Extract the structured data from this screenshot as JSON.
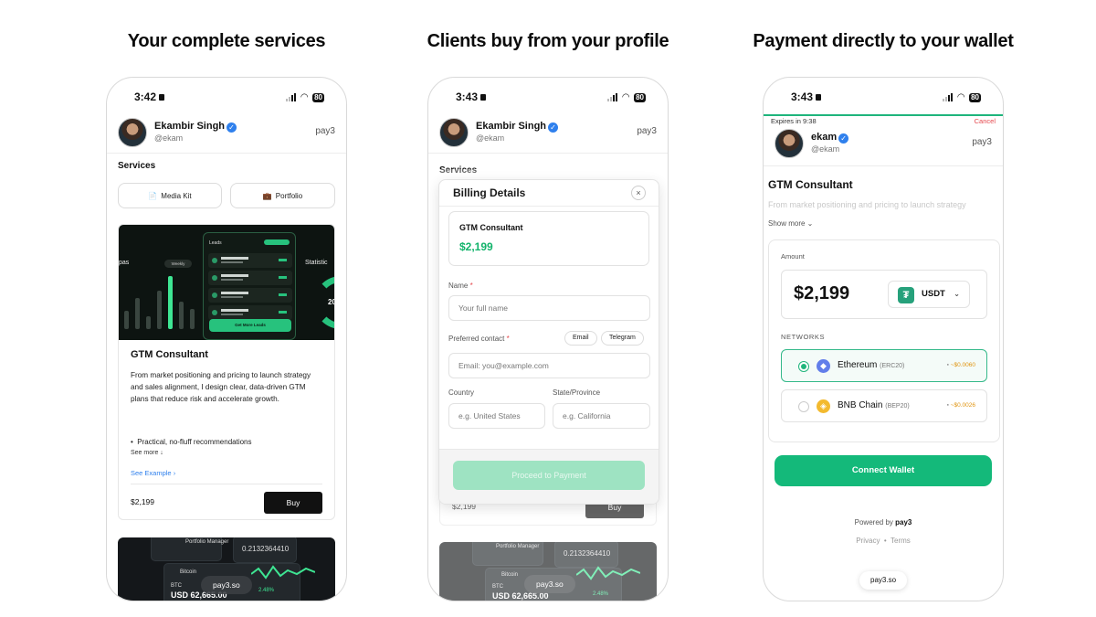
{
  "headings": [
    "Your complete services",
    "Clients buy from your profile",
    "Payment directly to your wallet"
  ],
  "status": {
    "p1_time": "3:42",
    "p2_time": "3:43",
    "p3_time": "3:43",
    "battery": "80"
  },
  "profile": {
    "name": "Ekambir Singh",
    "handle": "@ekam",
    "brand": "pay3",
    "short_name": "ekam"
  },
  "services": {
    "title": "Services",
    "media_kit": "Media Kit",
    "portfolio": "Portfolio"
  },
  "dashboard": {
    "leads": "Leads",
    "weekly": "Weekly",
    "get_more": "Get More Leads",
    "statistic": "Statistic",
    "pas": "pas",
    "ring_value": "20"
  },
  "service_card": {
    "title": "GTM Consultant",
    "description": "From market positioning and pricing to launch strategy and sales alignment, I design clear, data-driven GTM plans that reduce risk and accelerate growth.",
    "bullet": "Practical, no-fluff recommendations",
    "see_more": "See more ↓",
    "see_example": "See Example",
    "price": "$2,199",
    "buy": "Buy"
  },
  "promo": {
    "portfolio_manager": "Portfolio Manager",
    "big_number": "0.2132364410",
    "coin": "Bitcoin",
    "btc": "BTC",
    "usd": "USD 62,665.00",
    "pct": "2.48%",
    "pill": "pay3.so"
  },
  "billing": {
    "title": "Billing Details",
    "close": "×",
    "service_name": "GTM Consultant",
    "service_price": "$2,199",
    "name_label": "Name",
    "name_placeholder": "Your full name",
    "contact_label": "Preferred contact",
    "chip_email": "Email",
    "chip_telegram": "Telegram",
    "email_placeholder": "Email: you@example.com",
    "country_label": "Country",
    "country_placeholder": "e.g. United States",
    "state_label": "State/Province",
    "state_placeholder": "e.g. California",
    "proceed": "Proceed to Payment",
    "underlay_price": "$2,199",
    "underlay_buy": "Buy"
  },
  "payment": {
    "expires": "Expires in 9:38",
    "cancel": "Cancel",
    "title": "GTM Consultant",
    "desc": "From market positioning and pricing to launch strategy",
    "show_more": "Show more ⌄",
    "amount_label": "Amount",
    "amount": "$2,199",
    "token": "USDT",
    "networks_label": "NETWORKS",
    "networks": [
      {
        "name": "Ethereum",
        "tag": "(ERC20)",
        "fee": "~$0.0060",
        "selected": true
      },
      {
        "name": "BNB Chain",
        "tag": "(BEP20)",
        "fee": "~$0.0026",
        "selected": false
      }
    ],
    "connect": "Connect Wallet",
    "powered_prefix": "Powered by",
    "powered_brand": "pay3",
    "privacy": "Privacy",
    "terms": "Terms",
    "pill": "pay3.so"
  },
  "colors": {
    "accent_green": "#14b97a",
    "verified_blue": "#2f80ed",
    "cancel_red": "#e5484d"
  }
}
